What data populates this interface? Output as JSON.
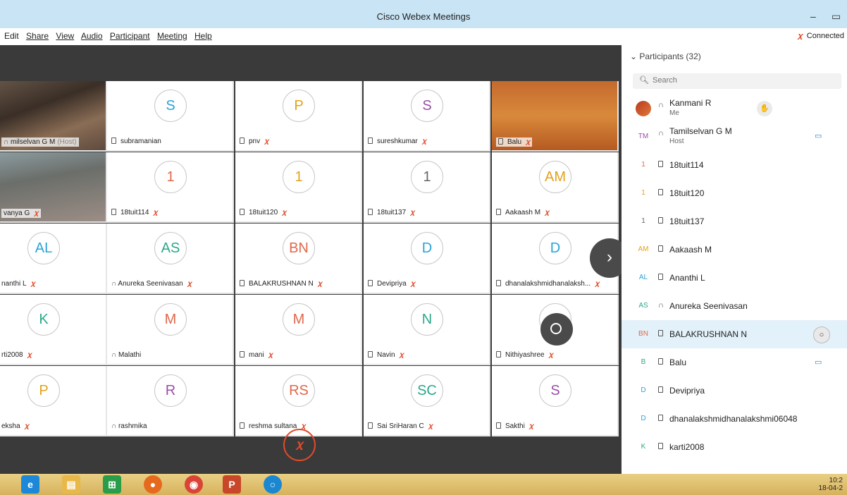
{
  "window": {
    "title": "Cisco Webex Meetings",
    "minimize": "–",
    "restore": "▭"
  },
  "menu": [
    "Edit",
    "Share",
    "View",
    "Audio",
    "Participant",
    "Meeting",
    "Help"
  ],
  "connection": {
    "icon": "mic-muted-icon",
    "label": "Connected"
  },
  "grid": {
    "tiles": [
      {
        "name": "milselvan G M",
        "suffix": "(Host)",
        "avatar": "",
        "photo": "photo1",
        "device": "headset",
        "muted": false,
        "avatar_color": "#000000"
      },
      {
        "name": "subramanian",
        "avatar": "S",
        "device": "phone",
        "muted": false,
        "avatar_color": "#2aa3d8"
      },
      {
        "name": "pnv",
        "avatar": "P",
        "device": "phone",
        "muted": true,
        "avatar_color": "#e3a21a"
      },
      {
        "name": "sureshkumar",
        "avatar": "S",
        "device": "phone",
        "muted": true,
        "avatar_color": "#9b4fa8"
      },
      {
        "name": "Balu",
        "avatar": "",
        "photo": "photo2",
        "device": "phone",
        "muted": true,
        "avatar_color": "#000000"
      },
      {
        "name": "vanya G",
        "avatar": "",
        "photo": "photo3",
        "device": "none",
        "muted": true,
        "avatar_color": "#000000"
      },
      {
        "name": "18tuit114",
        "avatar": "1",
        "device": "phone",
        "muted": true,
        "avatar_color": "#e0684a"
      },
      {
        "name": "18tuit120",
        "avatar": "1",
        "device": "phone",
        "muted": true,
        "avatar_color": "#e3a21a"
      },
      {
        "name": "18tuit137",
        "avatar": "1",
        "device": "phone",
        "muted": true,
        "avatar_color": "#666666"
      },
      {
        "name": "Aakaash M",
        "avatar": "AM",
        "device": "phone",
        "muted": true,
        "avatar_color": "#e3a21a"
      },
      {
        "name": "nanthi L",
        "avatar": "AL",
        "device": "none",
        "muted": true,
        "avatar_color": "#2aa3d8"
      },
      {
        "name": "Anureka Seenivasan",
        "avatar": "AS",
        "device": "headset",
        "muted": true,
        "avatar_color": "#2aa88a"
      },
      {
        "name": "BALAKRUSHNAN N",
        "avatar": "BN",
        "device": "phone",
        "muted": true,
        "avatar_color": "#e0684a"
      },
      {
        "name": "Devipriya",
        "avatar": "D",
        "device": "phone",
        "muted": true,
        "avatar_color": "#2aa3d8"
      },
      {
        "name": "dhanalakshmidhanalaksh...",
        "avatar": "D",
        "device": "phone",
        "muted": true,
        "avatar_color": "#2aa3d8"
      },
      {
        "name": "rti2008",
        "avatar": "K",
        "device": "none",
        "muted": true,
        "avatar_color": "#2aa88a"
      },
      {
        "name": "Malathi",
        "avatar": "M",
        "device": "headset",
        "muted": false,
        "avatar_color": "#e0684a"
      },
      {
        "name": "mani",
        "avatar": "M",
        "device": "phone",
        "muted": true,
        "avatar_color": "#e0684a"
      },
      {
        "name": "Navin",
        "avatar": "N",
        "device": "phone",
        "muted": true,
        "avatar_color": "#2aa88a"
      },
      {
        "name": "Nithiyashree",
        "avatar": "N",
        "device": "phone",
        "muted": true,
        "avatar_color": "#e0684a"
      },
      {
        "name": "eksha",
        "avatar": "P",
        "device": "none",
        "muted": true,
        "avatar_color": "#e3a21a"
      },
      {
        "name": "rashmika",
        "avatar": "R",
        "device": "headset",
        "muted": false,
        "avatar_color": "#9b4fa8"
      },
      {
        "name": "reshma sultana",
        "avatar": "RS",
        "device": "phone",
        "muted": true,
        "avatar_color": "#e0684a"
      },
      {
        "name": "Sai SriHaran C",
        "avatar": "SC",
        "device": "phone",
        "muted": true,
        "avatar_color": "#2aa88a"
      },
      {
        "name": "Sakthi",
        "avatar": "S",
        "device": "phone",
        "muted": true,
        "avatar_color": "#9b4fa8"
      }
    ],
    "next_icon": "›"
  },
  "panel": {
    "header": "Participants (32)",
    "search_placeholder": "Search",
    "participants": [
      {
        "name": "Kanmani R",
        "sub": "Me",
        "avatar": "",
        "device": "headset",
        "action": "raise-hand-icon",
        "action_glyph": "✋",
        "avatar_color": "#ffffff"
      },
      {
        "name": "Tamilselvan G M",
        "sub": "Host",
        "avatar": "TM",
        "device": "headset",
        "action": "video-icon",
        "action_glyph": "▭",
        "avatar_color": "#9b4fa8"
      },
      {
        "name": "18tuit114",
        "avatar": "1",
        "device": "phone",
        "avatar_color": "#e0684a"
      },
      {
        "name": "18tuit120",
        "avatar": "1",
        "device": "phone",
        "avatar_color": "#e3a21a"
      },
      {
        "name": "18tuit137",
        "avatar": "1",
        "device": "phone",
        "avatar_color": "#666666"
      },
      {
        "name": "Aakaash M",
        "avatar": "AM",
        "device": "phone",
        "avatar_color": "#e3a21a"
      },
      {
        "name": "Ananthi L",
        "avatar": "AL",
        "device": "phone",
        "avatar_color": "#2aa3d8"
      },
      {
        "name": "Anureka Seenivasan",
        "avatar": "AS",
        "device": "headset",
        "avatar_color": "#2aa88a"
      },
      {
        "name": "BALAKRUSHNAN N",
        "avatar": "BN",
        "device": "phone",
        "action": "chat-icon",
        "action_glyph": "○",
        "selected": true,
        "avatar_color": "#e0684a"
      },
      {
        "name": "Balu",
        "avatar": "B",
        "device": "phone",
        "action": "video-icon",
        "action_glyph": "▭",
        "avatar_color": "#2aa88a"
      },
      {
        "name": "Devipriya",
        "avatar": "D",
        "device": "phone",
        "avatar_color": "#2aa3d8"
      },
      {
        "name": "dhanalakshmidhanalakshmi06048",
        "avatar": "D",
        "device": "phone",
        "avatar_color": "#2aa3d8"
      },
      {
        "name": "karti2008",
        "avatar": "K",
        "device": "phone",
        "avatar_color": "#2aa88a"
      }
    ]
  },
  "taskbar": {
    "apps": [
      "internet-explorer-icon",
      "file-explorer-icon",
      "store-icon",
      "firefox-icon",
      "chrome-icon",
      "powerpoint-icon",
      "webex-icon"
    ],
    "clock_time": "10:2",
    "clock_date": "18-04-2"
  },
  "colors": {
    "mute": "#e04b2a",
    "accent": "#1a87d0",
    "stage": "#3a3a3a"
  }
}
